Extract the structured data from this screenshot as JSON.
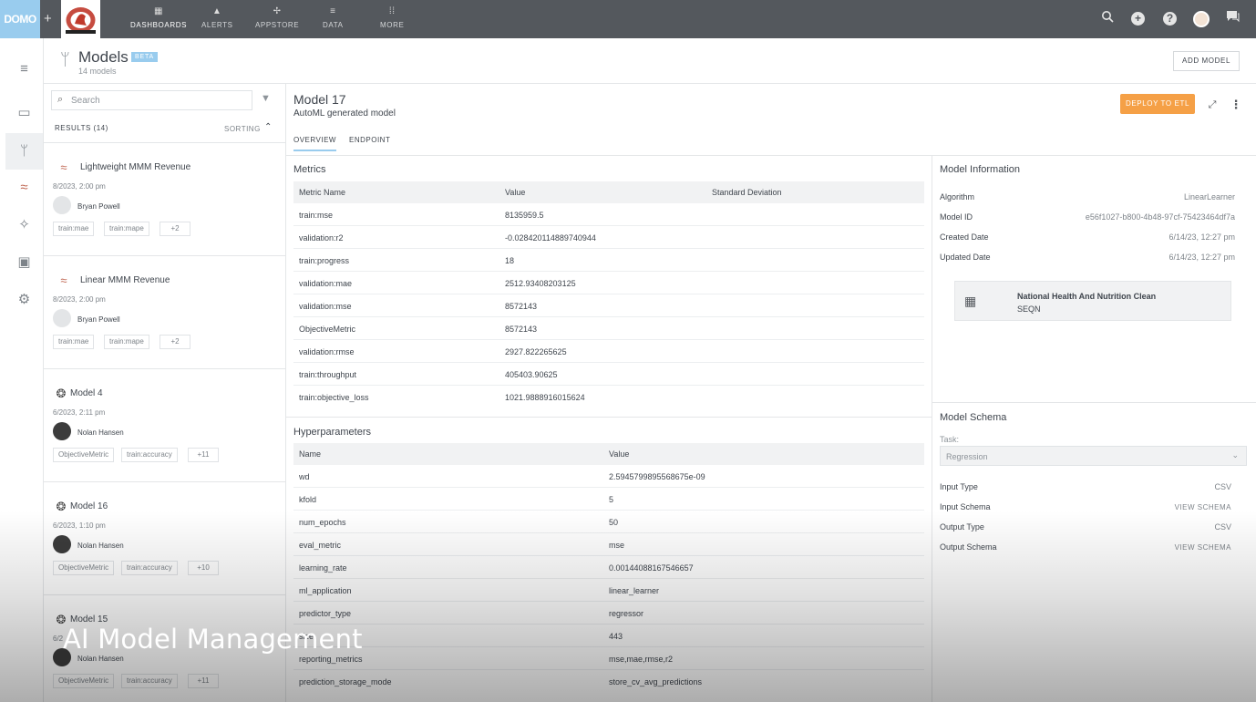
{
  "topbar": {
    "logo": "DOMO",
    "plus": "+",
    "nav": [
      {
        "label": "DASHBOARDS",
        "icon": "▦"
      },
      {
        "label": "ALERTS",
        "icon": "▲"
      },
      {
        "label": "APPSTORE",
        "icon": "✢"
      },
      {
        "label": "DATA",
        "icon": "≡"
      },
      {
        "label": "MORE",
        "icon": "⁞⁞"
      }
    ]
  },
  "header": {
    "title": "Models",
    "badge": "BETA",
    "subtitle": "14 models",
    "add_button": "ADD MODEL"
  },
  "list": {
    "search_placeholder": "Search",
    "results_label": "RESULTS (14)",
    "sorting_label": "SORTING",
    "cards": [
      {
        "title": "Lightweight MMM Revenue",
        "date": "8/2023, 2:00 pm",
        "user": "Bryan Powell",
        "tags": [
          "train:mae",
          "train:mape",
          "+2"
        ],
        "icon": "mmm-icon"
      },
      {
        "title": "Linear MMM Revenue",
        "date": "8/2023, 2:00 pm",
        "user": "Bryan Powell",
        "tags": [
          "train:mae",
          "train:mape",
          "+2"
        ],
        "icon": "mmm-icon"
      },
      {
        "title": "Model 4",
        "date": "6/2023, 2:11 pm",
        "user": "Nolan Hansen",
        "tags": [
          "ObjectiveMetric",
          "train:accuracy",
          "+11"
        ],
        "icon": "brain-icon"
      },
      {
        "title": "Model 16",
        "date": "6/2023, 1:10 pm",
        "user": "Nolan Hansen",
        "tags": [
          "ObjectiveMetric",
          "train:accuracy",
          "+10"
        ],
        "icon": "brain-icon"
      },
      {
        "title": "Model 15",
        "date": "6/2",
        "user": "Nolan Hansen",
        "tags": [
          "ObjectiveMetric",
          "train:accuracy",
          "+11"
        ],
        "icon": "brain-icon"
      }
    ]
  },
  "detail": {
    "title": "Model 17",
    "subtitle": "AutoML generated model",
    "deploy_button": "DEPLOY TO ETL",
    "tabs": [
      "OVERVIEW",
      "ENDPOINT"
    ],
    "metrics": {
      "section_title": "Metrics",
      "columns": [
        "Metric Name",
        "Value",
        "Standard Deviation"
      ],
      "rows": [
        [
          "train:mse",
          "8135959.5"
        ],
        [
          "validation:r2",
          "-0.028420114889740944"
        ],
        [
          "train:progress",
          "18"
        ],
        [
          "validation:mae",
          "2512.93408203125"
        ],
        [
          "validation:mse",
          "8572143"
        ],
        [
          "ObjectiveMetric",
          "8572143"
        ],
        [
          "validation:rmse",
          "2927.822265625"
        ],
        [
          "train:throughput",
          "405403.90625"
        ],
        [
          "train:objective_loss",
          "1021.9888916015624"
        ]
      ]
    },
    "hyperparameters": {
      "section_title": "Hyperparameters",
      "columns": [
        "Name",
        "Value"
      ],
      "rows": [
        [
          "wd",
          "2.5945799895568675e-09"
        ],
        [
          "kfold",
          "5"
        ],
        [
          "num_epochs",
          "50"
        ],
        [
          "eval_metric",
          "mse"
        ],
        [
          "learning_rate",
          "0.00144088167546657"
        ],
        [
          "ml_application",
          "linear_learner"
        ],
        [
          "predictor_type",
          "regressor"
        ],
        [
          "size",
          "443"
        ],
        [
          "reporting_metrics",
          "mse,mae,rmse,r2"
        ],
        [
          "prediction_storage_mode",
          "store_cv_avg_predictions"
        ]
      ]
    }
  },
  "model_info": {
    "title": "Model Information",
    "rows": [
      {
        "key": "Algorithm",
        "value": "LinearLearner"
      },
      {
        "key": "Model ID",
        "value": "e56f1027-b800-4b48-97cf-75423464df7a"
      },
      {
        "key": "Created Date",
        "value": "6/14/23, 12:27 pm"
      },
      {
        "key": "Updated Date",
        "value": "6/14/23, 12:27 pm"
      }
    ],
    "dataset_name": "National Health And Nutrition Clean",
    "dataset_sub": "SEQN"
  },
  "model_schema": {
    "title": "Model Schema",
    "task_label": "Task:",
    "task_value": "Regression",
    "rows": [
      {
        "key": "Input Type",
        "value": "CSV"
      },
      {
        "key": "Input Schema",
        "value": "VIEW SCHEMA"
      },
      {
        "key": "Output Type",
        "value": "CSV"
      },
      {
        "key": "Output Schema",
        "value": "VIEW SCHEMA"
      }
    ]
  },
  "caption": "AI Model Management",
  "colors": {
    "accent": "#99ccee",
    "deploy": "#f5a046",
    "topbar": "#54585d"
  }
}
